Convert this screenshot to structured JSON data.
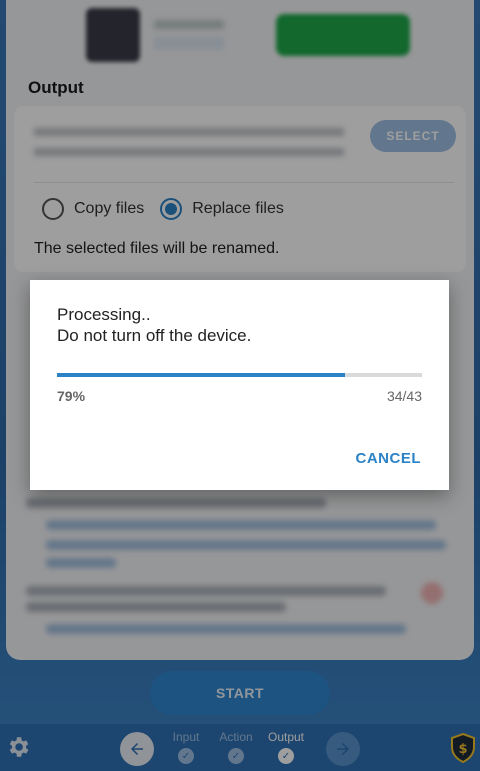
{
  "output": {
    "section_title": "Output",
    "select_label": "SELECT",
    "copy_label": "Copy files",
    "replace_label": "Replace files",
    "selected_option": "Replace files",
    "note": "The selected files will be renamed."
  },
  "start_label": "START",
  "nav": {
    "steps": [
      {
        "label": "Input",
        "state": "done"
      },
      {
        "label": "Action",
        "state": "done"
      },
      {
        "label": "Output",
        "state": "active"
      }
    ]
  },
  "dialog": {
    "line1": "Processing..",
    "line2": "Do not turn off the device.",
    "progress_fraction": 0.79,
    "percent_text": "79%",
    "count_text": "34/43",
    "cancel_label": "CANCEL"
  },
  "colors": {
    "accent": "#2b82c6",
    "nav_background": "#2e70b4"
  },
  "icons": {
    "settings": "gear-icon",
    "back": "arrow-left-icon",
    "forward": "arrow-right-icon",
    "premium": "shield-dollar-icon",
    "step_done": "check-icon"
  }
}
